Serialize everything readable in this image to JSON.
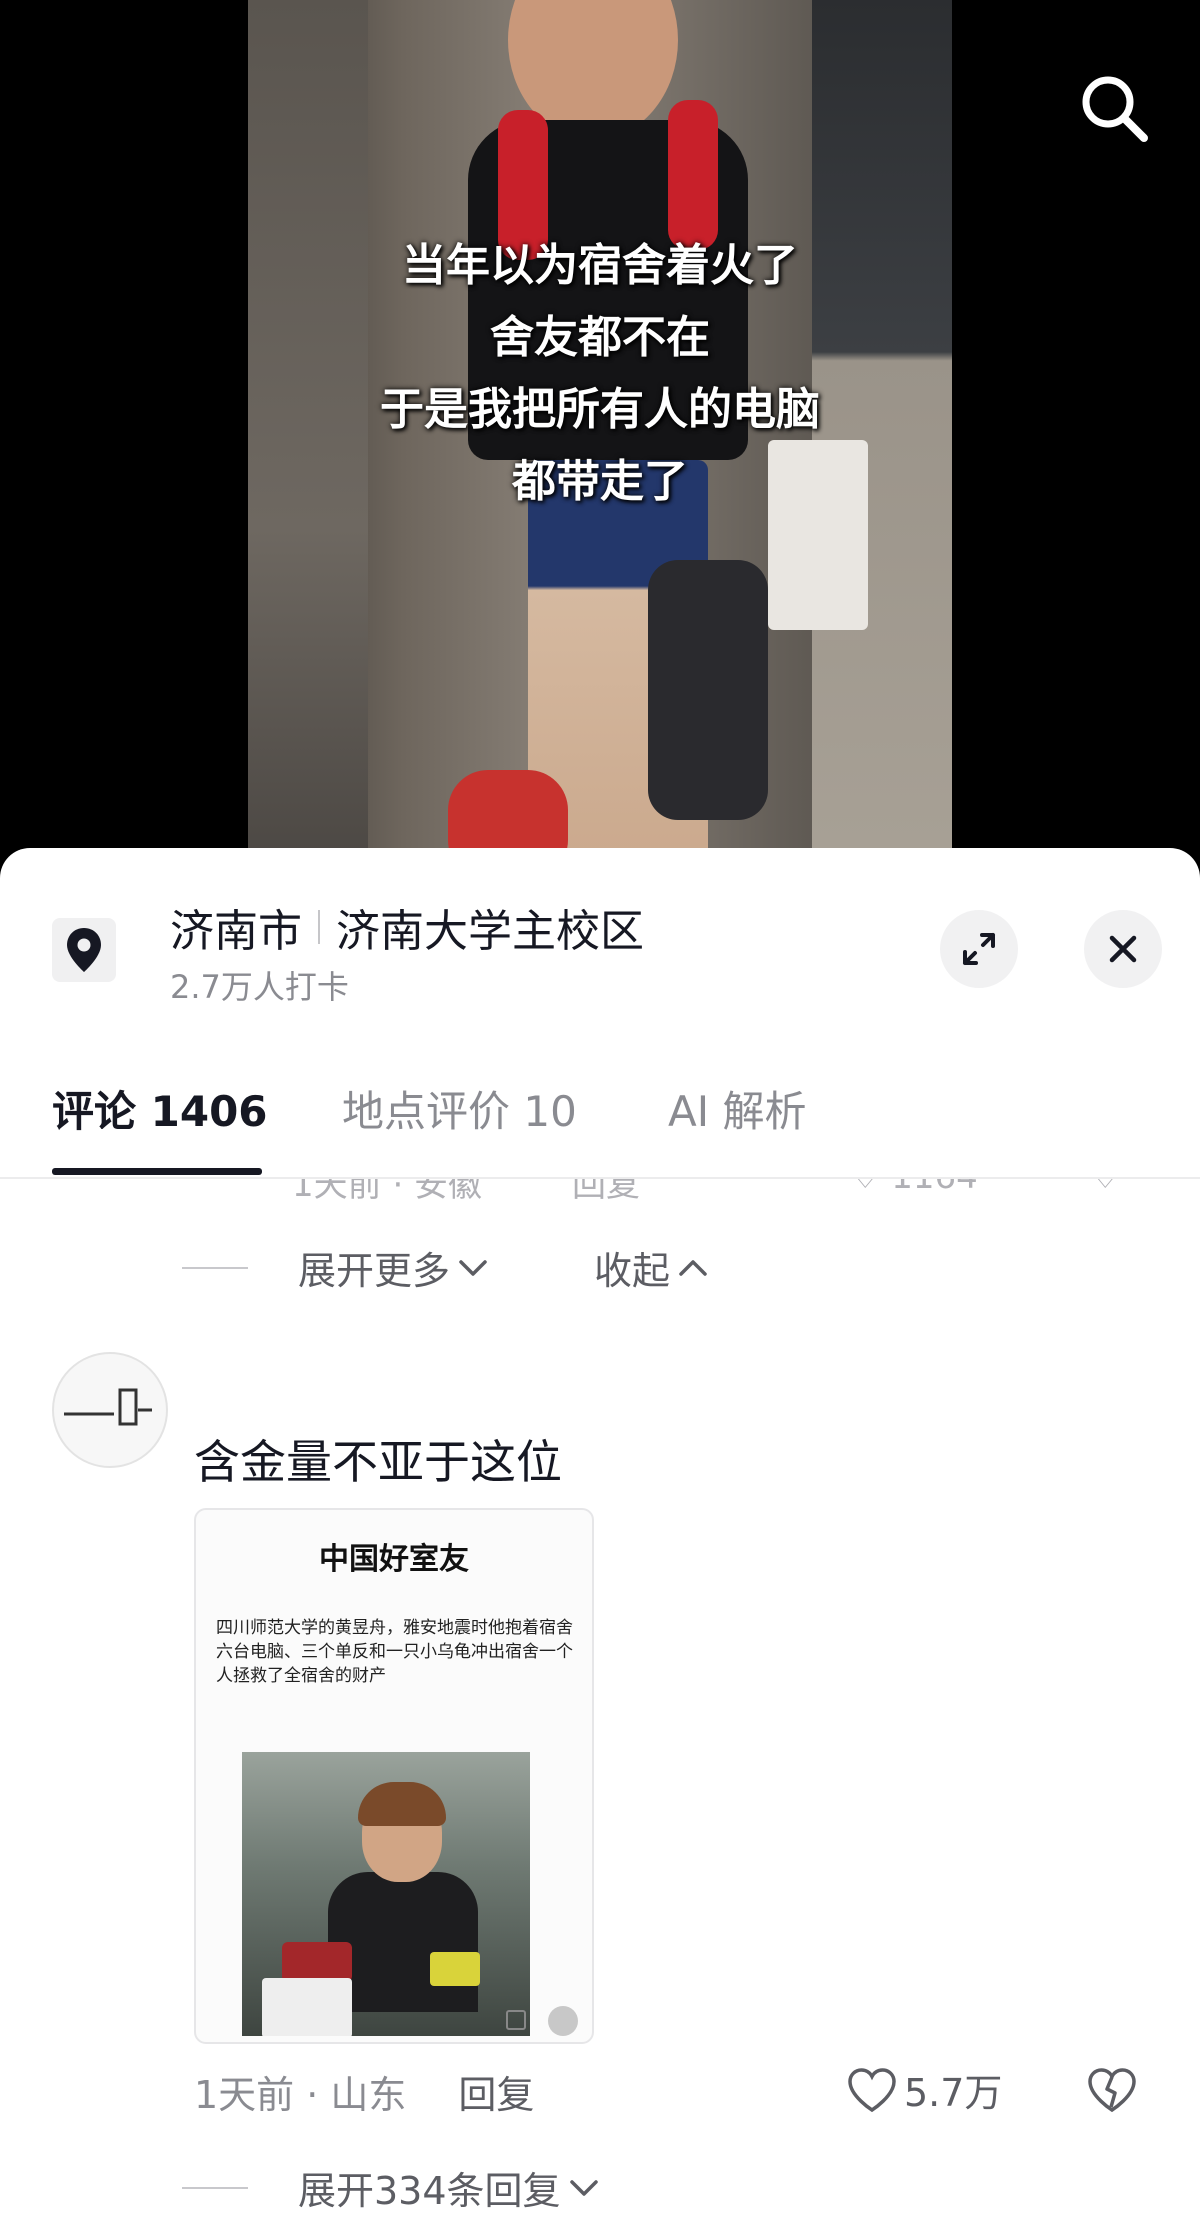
{
  "video": {
    "caption_lines": [
      "当年以为宿舍着火了",
      "舍友都不在",
      "于是我把所有人的电脑",
      "都带走了"
    ]
  },
  "location": {
    "city": "济南市",
    "place": "济南大学主校区",
    "checkins": "2.7万人打卡"
  },
  "tabs": [
    {
      "label": "评论 1406"
    },
    {
      "label": "地点评价 10"
    },
    {
      "label": "AI 解析"
    }
  ],
  "thread_controls": {
    "expand_more": "展开更多",
    "collapse": "收起"
  },
  "comment": {
    "text": "含金量不亚于这位",
    "image_card": {
      "title": "中国好室友",
      "body": "四川师范大学的黄昱舟，雅安地震时他抱着宿舍六台电脑、三个单反和一只小乌龟冲出宿舍一个人拯救了全宿舍的财产"
    },
    "time_location": "1天前 · 山东",
    "reply_label": "回复",
    "likes": "5.7万",
    "expand_replies": "展开334条回复"
  }
}
